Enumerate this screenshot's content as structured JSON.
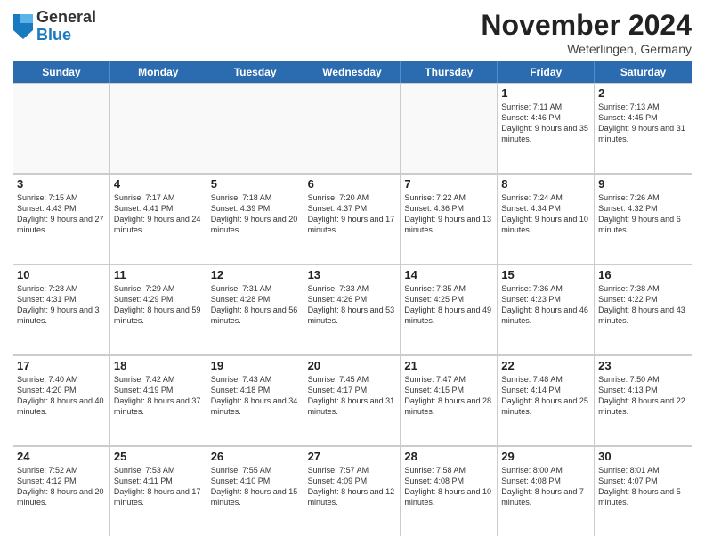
{
  "header": {
    "logo_general": "General",
    "logo_blue": "Blue",
    "month_title": "November 2024",
    "location": "Weferlingen, Germany"
  },
  "weekdays": [
    "Sunday",
    "Monday",
    "Tuesday",
    "Wednesday",
    "Thursday",
    "Friday",
    "Saturday"
  ],
  "rows": [
    [
      {
        "day": "",
        "info": "",
        "empty": true
      },
      {
        "day": "",
        "info": "",
        "empty": true
      },
      {
        "day": "",
        "info": "",
        "empty": true
      },
      {
        "day": "",
        "info": "",
        "empty": true
      },
      {
        "day": "",
        "info": "",
        "empty": true
      },
      {
        "day": "1",
        "info": "Sunrise: 7:11 AM\nSunset: 4:46 PM\nDaylight: 9 hours and 35 minutes."
      },
      {
        "day": "2",
        "info": "Sunrise: 7:13 AM\nSunset: 4:45 PM\nDaylight: 9 hours and 31 minutes."
      }
    ],
    [
      {
        "day": "3",
        "info": "Sunrise: 7:15 AM\nSunset: 4:43 PM\nDaylight: 9 hours and 27 minutes."
      },
      {
        "day": "4",
        "info": "Sunrise: 7:17 AM\nSunset: 4:41 PM\nDaylight: 9 hours and 24 minutes."
      },
      {
        "day": "5",
        "info": "Sunrise: 7:18 AM\nSunset: 4:39 PM\nDaylight: 9 hours and 20 minutes."
      },
      {
        "day": "6",
        "info": "Sunrise: 7:20 AM\nSunset: 4:37 PM\nDaylight: 9 hours and 17 minutes."
      },
      {
        "day": "7",
        "info": "Sunrise: 7:22 AM\nSunset: 4:36 PM\nDaylight: 9 hours and 13 minutes."
      },
      {
        "day": "8",
        "info": "Sunrise: 7:24 AM\nSunset: 4:34 PM\nDaylight: 9 hours and 10 minutes."
      },
      {
        "day": "9",
        "info": "Sunrise: 7:26 AM\nSunset: 4:32 PM\nDaylight: 9 hours and 6 minutes."
      }
    ],
    [
      {
        "day": "10",
        "info": "Sunrise: 7:28 AM\nSunset: 4:31 PM\nDaylight: 9 hours and 3 minutes."
      },
      {
        "day": "11",
        "info": "Sunrise: 7:29 AM\nSunset: 4:29 PM\nDaylight: 8 hours and 59 minutes."
      },
      {
        "day": "12",
        "info": "Sunrise: 7:31 AM\nSunset: 4:28 PM\nDaylight: 8 hours and 56 minutes."
      },
      {
        "day": "13",
        "info": "Sunrise: 7:33 AM\nSunset: 4:26 PM\nDaylight: 8 hours and 53 minutes."
      },
      {
        "day": "14",
        "info": "Sunrise: 7:35 AM\nSunset: 4:25 PM\nDaylight: 8 hours and 49 minutes."
      },
      {
        "day": "15",
        "info": "Sunrise: 7:36 AM\nSunset: 4:23 PM\nDaylight: 8 hours and 46 minutes."
      },
      {
        "day": "16",
        "info": "Sunrise: 7:38 AM\nSunset: 4:22 PM\nDaylight: 8 hours and 43 minutes."
      }
    ],
    [
      {
        "day": "17",
        "info": "Sunrise: 7:40 AM\nSunset: 4:20 PM\nDaylight: 8 hours and 40 minutes."
      },
      {
        "day": "18",
        "info": "Sunrise: 7:42 AM\nSunset: 4:19 PM\nDaylight: 8 hours and 37 minutes."
      },
      {
        "day": "19",
        "info": "Sunrise: 7:43 AM\nSunset: 4:18 PM\nDaylight: 8 hours and 34 minutes."
      },
      {
        "day": "20",
        "info": "Sunrise: 7:45 AM\nSunset: 4:17 PM\nDaylight: 8 hours and 31 minutes."
      },
      {
        "day": "21",
        "info": "Sunrise: 7:47 AM\nSunset: 4:15 PM\nDaylight: 8 hours and 28 minutes."
      },
      {
        "day": "22",
        "info": "Sunrise: 7:48 AM\nSunset: 4:14 PM\nDaylight: 8 hours and 25 minutes."
      },
      {
        "day": "23",
        "info": "Sunrise: 7:50 AM\nSunset: 4:13 PM\nDaylight: 8 hours and 22 minutes."
      }
    ],
    [
      {
        "day": "24",
        "info": "Sunrise: 7:52 AM\nSunset: 4:12 PM\nDaylight: 8 hours and 20 minutes."
      },
      {
        "day": "25",
        "info": "Sunrise: 7:53 AM\nSunset: 4:11 PM\nDaylight: 8 hours and 17 minutes."
      },
      {
        "day": "26",
        "info": "Sunrise: 7:55 AM\nSunset: 4:10 PM\nDaylight: 8 hours and 15 minutes."
      },
      {
        "day": "27",
        "info": "Sunrise: 7:57 AM\nSunset: 4:09 PM\nDaylight: 8 hours and 12 minutes."
      },
      {
        "day": "28",
        "info": "Sunrise: 7:58 AM\nSunset: 4:08 PM\nDaylight: 8 hours and 10 minutes."
      },
      {
        "day": "29",
        "info": "Sunrise: 8:00 AM\nSunset: 4:08 PM\nDaylight: 8 hours and 7 minutes."
      },
      {
        "day": "30",
        "info": "Sunrise: 8:01 AM\nSunset: 4:07 PM\nDaylight: 8 hours and 5 minutes."
      }
    ]
  ]
}
